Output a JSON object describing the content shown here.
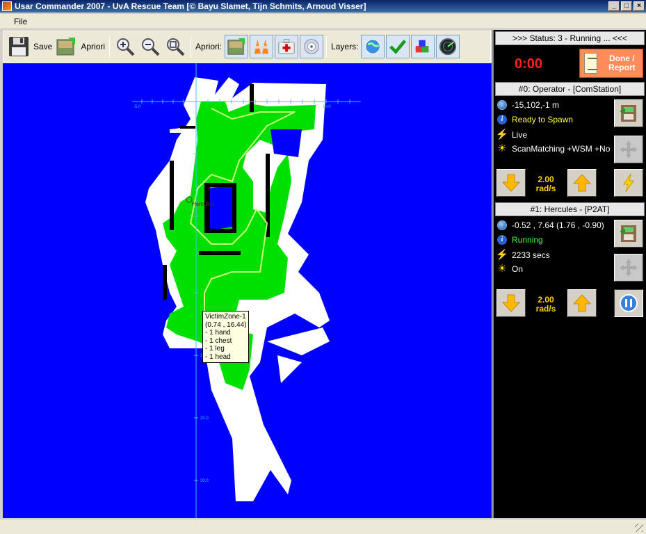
{
  "window": {
    "title": "Usar Commander 2007 - UvA Rescue Team [© Bayu Slamet, Tijn Schmits, Arnoud Visser]"
  },
  "menu": {
    "file_label": "File"
  },
  "toolbar": {
    "save_label": "Save",
    "apriori_label": "Apriori",
    "apriori_group_label": "Apriori:",
    "layers_label": "Layers:"
  },
  "map": {
    "tooltip": "VictimZone-1\n(0.74 , 16.44)\n- 1 hand\n- 1 chest\n- 1 leg\n- 1 head",
    "robot_label": "Hercules",
    "axis_labels": {
      "x_left": "-5.0",
      "x_right": "10.0",
      "y_10": "10.0",
      "y_20": "20.0",
      "y_30": "30.0",
      "x_mid": "0.0"
    }
  },
  "status": {
    "header": ">>> Status: 3 - Running ... <<<",
    "timer": "0:00",
    "done_label": "Done / Report"
  },
  "robots": [
    {
      "header": "#0: Operator - [ComStation]",
      "position": "-15,102,-1 m",
      "state": "Ready to Spawn",
      "power": "Live",
      "mode": "ScanMatching +WSM +No",
      "speed_value": "2.00",
      "speed_unit": "rad/s"
    },
    {
      "header": "#1: Hercules - [P2AT]",
      "position": "-0.52 , 7.64 (1.76 , -0.90)",
      "state": "Running",
      "power": "2233 secs",
      "mode": "On",
      "speed_value": "2.00",
      "speed_unit": "rad/s"
    }
  ],
  "colors": {
    "map_background": "#0000ff",
    "explored": "#00e000",
    "walls": "#ffffff",
    "timer": "#ff2020",
    "done_button": "#ff8c5a"
  }
}
